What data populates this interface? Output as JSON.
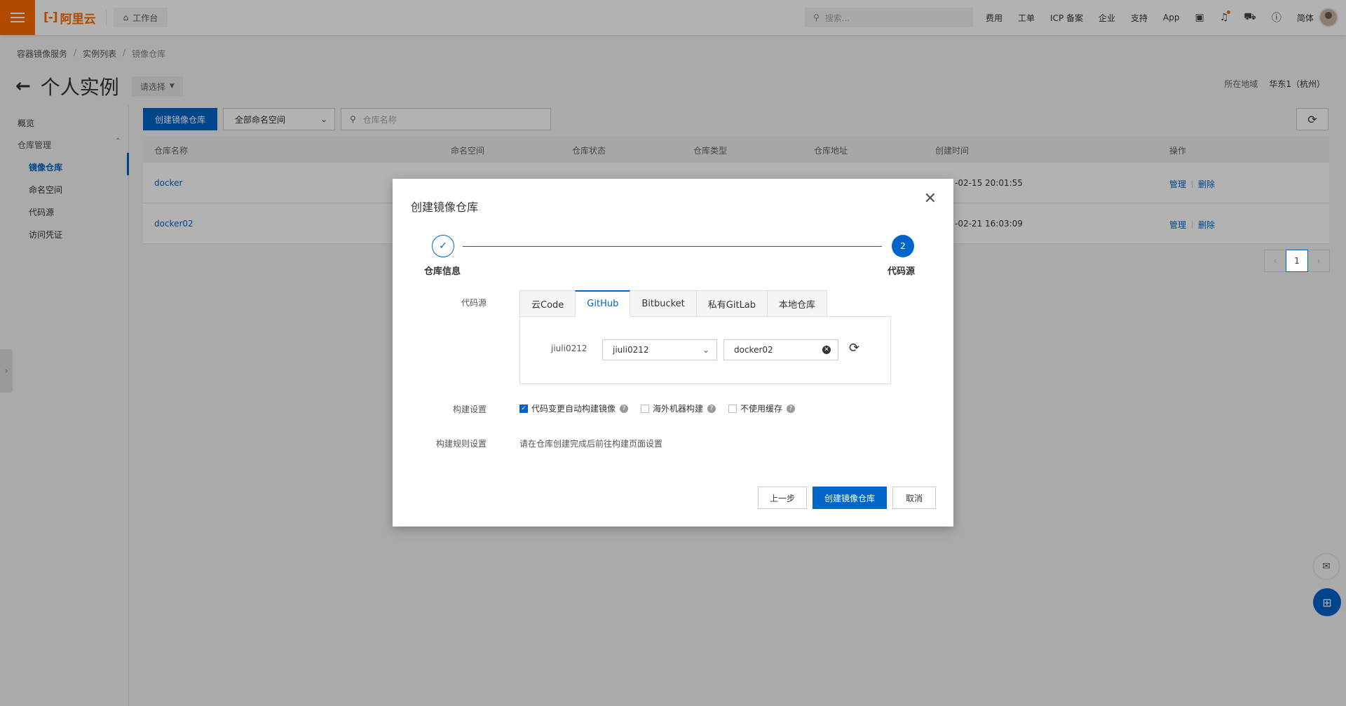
{
  "topbar": {
    "logo_text": "阿里云",
    "logo_mark": "[-]",
    "workbench_label": "工作台",
    "search_placeholder": "搜索...",
    "links": [
      "费用",
      "工单",
      "ICP 备案",
      "企业",
      "支持",
      "App"
    ],
    "lang": "简体"
  },
  "breadcrumb": [
    "容器镜像服务",
    "实例列表",
    "镜像仓库"
  ],
  "page": {
    "title": "个人实例",
    "select_label": "请选择",
    "region_label": "所在地域",
    "region_value": "华东1（杭州）"
  },
  "sidebar": {
    "overview": "概览",
    "group": "仓库管理",
    "items": [
      "镜像仓库",
      "命名空间",
      "代码源",
      "访问凭证"
    ]
  },
  "toolbar": {
    "create_label": "创建镜像仓库",
    "namespace_select": "全部命名空间",
    "search_placeholder": "仓库名称"
  },
  "table": {
    "columns": [
      "仓库名称",
      "命名空间",
      "仓库状态",
      "仓库类型",
      "仓库地址",
      "创建时间",
      "操作"
    ],
    "rows": [
      {
        "name": "docker",
        "time": "-02-15 20:01:55",
        "manage": "管理",
        "delete": "删除"
      },
      {
        "name": "docker02",
        "time": "-02-21 16:03:09",
        "manage": "管理",
        "delete": "删除"
      }
    ]
  },
  "pager": {
    "prev": "‹",
    "page": "1",
    "next": "›"
  },
  "dialog": {
    "title": "创建镜像仓库",
    "steps": [
      {
        "label": "仓库信息",
        "mark": "✓"
      },
      {
        "label": "代码源",
        "mark": "2"
      }
    ],
    "source_label": "代码源",
    "tabs": [
      "云Code",
      "GitHub",
      "Bitbucket",
      "私有GitLab",
      "本地仓库"
    ],
    "account_label": "jiuli0212",
    "account_value": "jiuli0212",
    "repo_value": "docker02",
    "build_label": "构建设置",
    "checks": [
      {
        "label": "代码变更自动构建镜像",
        "checked": true
      },
      {
        "label": "海外机器构建",
        "checked": false
      },
      {
        "label": "不使用缓存",
        "checked": false
      }
    ],
    "rule_label": "构建规则设置",
    "rule_text": "请在仓库创建完成后前往构建页面设置",
    "btn_prev": "上一步",
    "btn_submit": "创建镜像仓库",
    "btn_cancel": "取消"
  },
  "colors": {
    "primary": "#0064c8",
    "brand": "#ff6a00"
  }
}
